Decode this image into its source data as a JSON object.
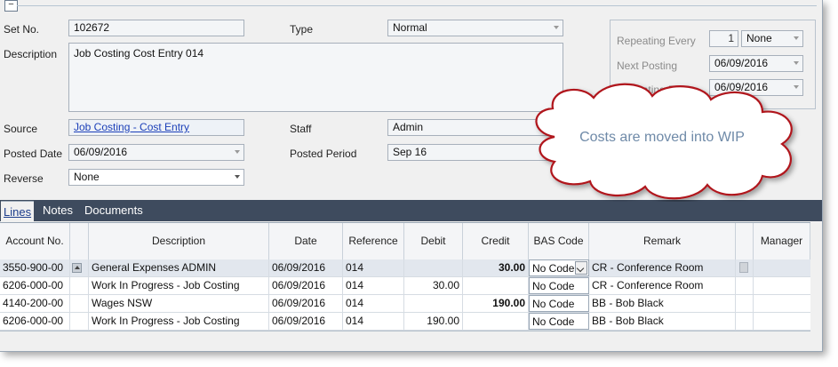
{
  "form": {
    "set_no_label": "Set No.",
    "set_no_value": "102672",
    "type_label": "Type",
    "type_value": "Normal",
    "description_label": "Description",
    "description_value": "Job Costing Cost Entry 014",
    "source_label": "Source",
    "source_value": "Job Costing - Cost Entry",
    "staff_label": "Staff",
    "staff_value": "Admin",
    "posted_date_label": "Posted Date",
    "posted_date_value": "06/09/2016",
    "posted_period_label": "Posted Period",
    "posted_period_value": "Sep 16",
    "reverse_label": "Reverse",
    "reverse_value": "None"
  },
  "repeating": {
    "every_label": "Repeating Every",
    "every_count": "1",
    "every_unit": "None",
    "next_posting_label": "Next Posting",
    "next_posting_value": "06/09/2016",
    "repeating_label": "Repeating D",
    "repeating_value": "06/09/2016"
  },
  "callout": {
    "text": "Costs are moved into WIP"
  },
  "tabs": [
    {
      "label": "Lines"
    },
    {
      "label": "Notes"
    },
    {
      "label": "Documents"
    }
  ],
  "grid": {
    "columns": [
      "Account No.",
      "Description",
      "Date",
      "Reference",
      "Debit",
      "Credit",
      "BAS Code",
      "Remark",
      "Manager"
    ],
    "rows": [
      {
        "account": "3550-900-00",
        "description": "General Expenses ADMIN",
        "date": "06/09/2016",
        "reference": "014",
        "debit": "",
        "credit": "30.00",
        "bas": "No Code",
        "remark": "CR - Conference Room"
      },
      {
        "account": "6206-000-00",
        "description": "Work In Progress - Job Costing",
        "date": "06/09/2016",
        "reference": "014",
        "debit": "30.00",
        "credit": "",
        "bas": "No Code",
        "remark": "CR - Conference Room"
      },
      {
        "account": "4140-200-00",
        "description": "Wages NSW",
        "date": "06/09/2016",
        "reference": "014",
        "debit": "",
        "credit": "190.00",
        "bas": "No Code",
        "remark": "BB - Bob Black"
      },
      {
        "account": "6206-000-00",
        "description": "Work In Progress - Job Costing",
        "date": "06/09/2016",
        "reference": "014",
        "debit": "190.00",
        "credit": "",
        "bas": "No Code",
        "remark": "BB - Bob Black"
      }
    ]
  }
}
